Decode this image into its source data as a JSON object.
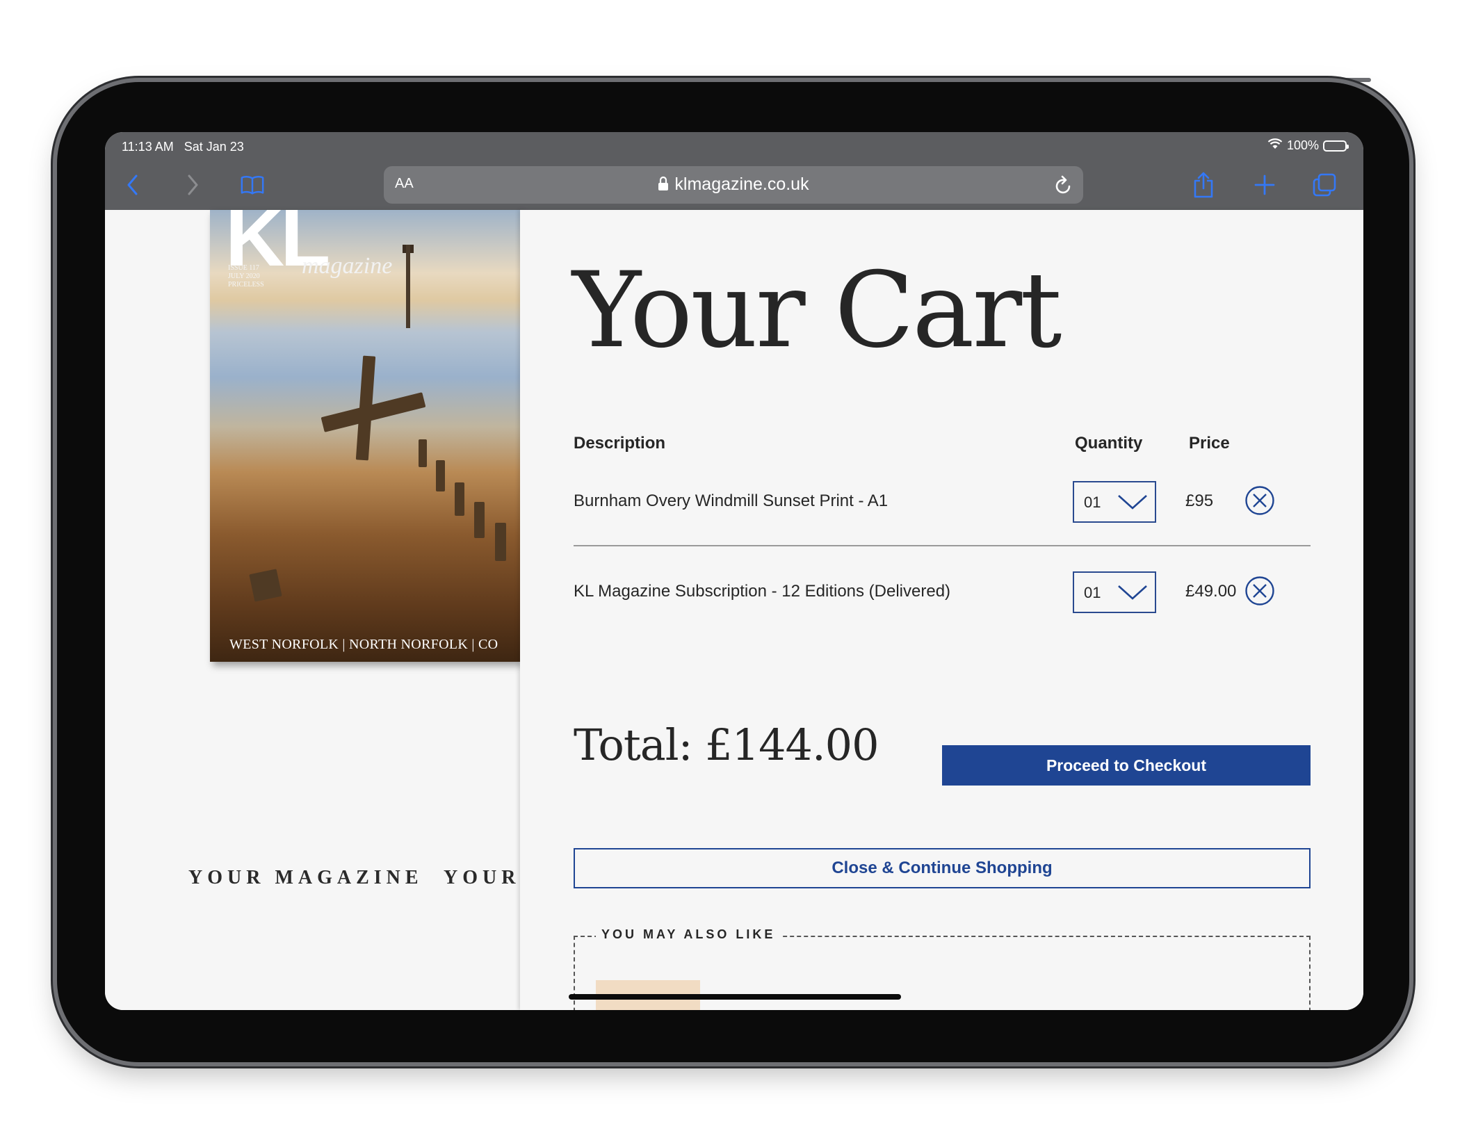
{
  "status_bar": {
    "time": "11:13 AM",
    "date": "Sat Jan 23",
    "battery": "100%"
  },
  "browser": {
    "aa": "AA",
    "url": "klmagazine.co.uk"
  },
  "cover": {
    "logo": "KL",
    "script": "magazine",
    "issue_line1": "ISSUE 117",
    "issue_line2": "JULY 2020",
    "issue_line3": "PRICELESS",
    "strapline": "WEST NORFOLK | NORTH NORFOLK | CO"
  },
  "site_nav": [
    "YOUR MAGAZINE",
    "YOUR"
  ],
  "cart": {
    "title": "Your Cart",
    "columns": {
      "description": "Description",
      "quantity": "Quantity",
      "price": "Price"
    },
    "items": [
      {
        "description": "Burnham Overy Windmill Sunset Print - A1",
        "quantity": "01",
        "price": "£95"
      },
      {
        "description": "KL Magazine Subscription - 12 Editions (Delivered)",
        "quantity": "01",
        "price": "£49.00"
      }
    ],
    "total": "Total: £144.00",
    "checkout_label": "Proceed to Checkout",
    "continue_label": "Close & Continue Shopping",
    "also_like": "YOU MAY ALSO LIKE"
  },
  "colors": {
    "accent": "#1f4593",
    "text": "#262626",
    "chrome": "#5c5d60",
    "safari_blue": "#3478f6"
  }
}
